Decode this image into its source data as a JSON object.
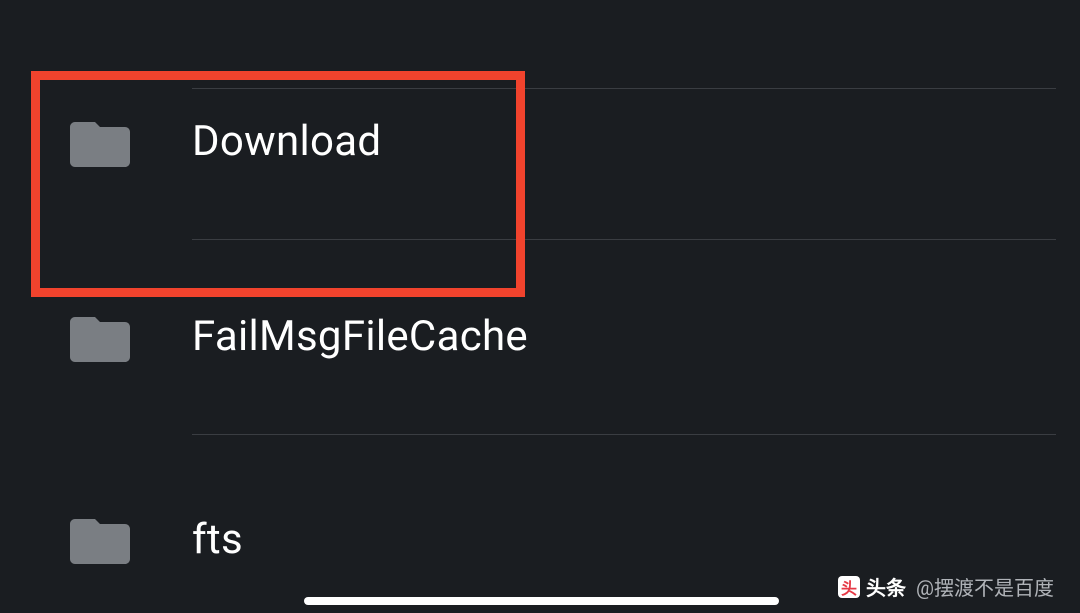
{
  "folders": [
    {
      "label": "Download"
    },
    {
      "label": "FailMsgFileCache"
    },
    {
      "label": "fts"
    }
  ],
  "highlight_index": 0,
  "watermark": {
    "brand": "头条",
    "user": "@摆渡不是百度"
  }
}
